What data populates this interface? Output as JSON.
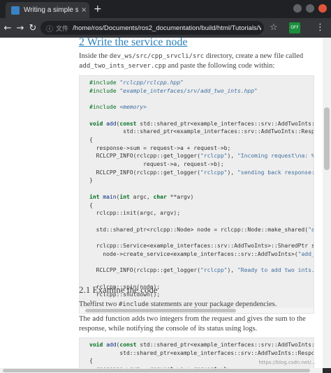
{
  "browser": {
    "tab_title": "Writing a simple service a",
    "tab_close": "×",
    "new_tab": "+",
    "back": "←",
    "forward": "→",
    "reload": "↻",
    "info_icon": "ⓘ",
    "url_label": "文件",
    "url": "/home/ros/Documents/ros2_documentation/build/html/Tutorials/Writing-A-Simple-...",
    "star": "☆",
    "ext_label": "OFF",
    "menu": "⋮"
  },
  "doc": {
    "heading": "2 Write the service node",
    "intro_pre": "Inside the ",
    "intro_path": "dev_ws/src/cpp_srvcli/src",
    "intro_mid": " directory, create a new file called",
    "intro_file": "add_two_ints_server.cpp",
    "intro_post": " and paste the following code within:",
    "code1": [
      "#include \"rclcpp/rclcpp.hpp\"",
      "#include \"example_interfaces/srv/add_two_ints.hpp\"",
      "",
      "#include <memory>",
      "",
      "void add(const std::shared_ptr<example_interfaces::srv::AddTwoInts::Request> request,",
      "          std::shared_ptr<example_interfaces::srv::AddTwoInts::Response>      response)",
      "{",
      "  response->sum = request->a + request->b;",
      "  RCLCPP_INFO(rclcpp::get_logger(\"rclcpp\"), \"Incoming request\\na: %ld\" \" b: %ld\",",
      "                request->a, request->b);",
      "  RCLCPP_INFO(rclcpp::get_logger(\"rclcpp\"), \"sending back response: [%ld]\", (long int)response->sum);",
      "}",
      "",
      "int main(int argc, char **argv)",
      "{",
      "  rclcpp::init(argc, argv);",
      "",
      "  std::shared_ptr<rclcpp::Node> node = rclcpp::Node::make_shared(\"add_two_ints_server\");",
      "",
      "  rclcpp::Service<example_interfaces::srv::AddTwoInts>::SharedPtr service =",
      "    node->create_service<example_interfaces::srv::AddTwoInts>(\"add_two_ints\", &add);",
      "",
      "  RCLCPP_INFO(rclcpp::get_logger(\"rclcpp\"), \"Ready to add two ints.\");",
      "",
      "  rclcpp::spin(node);",
      "  rclcpp::shutdown();",
      "}"
    ],
    "subheading": "2.1 Examine the code",
    "p1_pre": "The first two ",
    "p1_code": "#include",
    "p1_post": " statements are your package dependencies.",
    "p2_pre": "The ",
    "p2_code": "add",
    "p2_post": " function adds two integers from the request and gives the sum to the response, while notifying the console of its status using logs.",
    "code2": [
      "void add(const std::shared_ptr<example_interfaces::srv::AddTwoInts::Request> request,",
      "         std::shared_ptr<example_interfaces::srv::AddTwoInts::Response>      response)",
      "{",
      "  response->sum = request->a + request->b;"
    ],
    "watermark": "https://blog.csdn.net/..."
  }
}
